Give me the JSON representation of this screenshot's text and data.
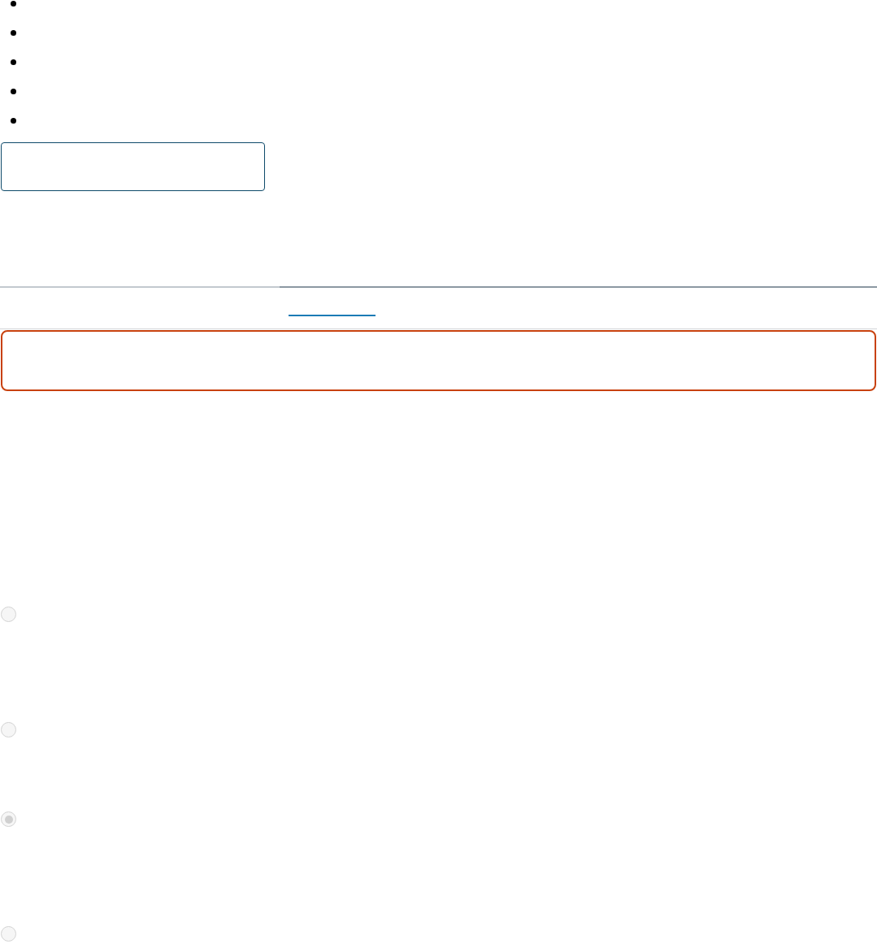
{
  "list_items": [
    {
      "kind": "bullet"
    },
    {
      "kind": "bullet"
    },
    {
      "kind": "bullet"
    },
    {
      "kind": "bullet"
    },
    {
      "kind": "bullet"
    }
  ],
  "text_field": {
    "focused": true
  },
  "link": {
    "underlined": true
  },
  "alert": {
    "error": true
  },
  "radio_options": [
    {
      "selected": false,
      "disabled": true
    },
    {
      "selected": false,
      "disabled": true
    },
    {
      "selected": true,
      "disabled": true
    },
    {
      "selected": false,
      "disabled": true
    }
  ]
}
